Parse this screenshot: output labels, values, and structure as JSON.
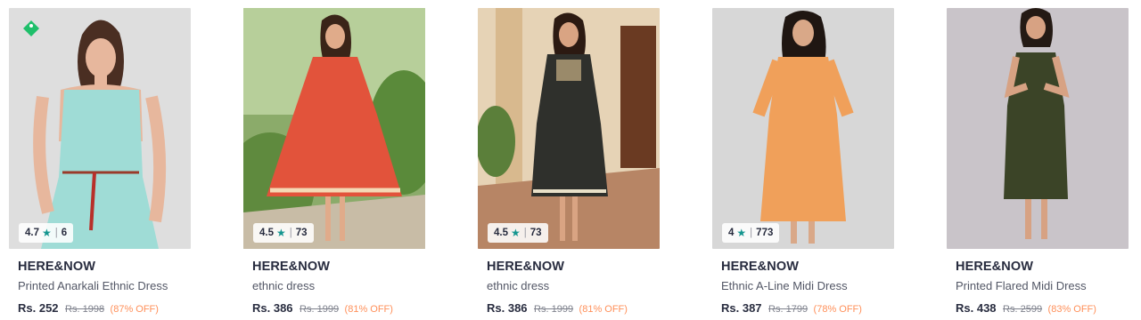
{
  "products": [
    {
      "brand": "HERE&NOW",
      "name": "Printed Anarkali Ethnic Dress",
      "price": "Rs. 252",
      "mrp": "Rs. 1998",
      "discount": "(87% OFF)",
      "rating": "4.7",
      "rating_count": "6",
      "dress_color": "#9fdcd6",
      "has_badge": true
    },
    {
      "brand": "HERE&NOW",
      "name": "ethnic dress",
      "price": "Rs. 386",
      "mrp": "Rs. 1999",
      "discount": "(81% OFF)",
      "rating": "4.5",
      "rating_count": "73",
      "dress_color": "#e2533b"
    },
    {
      "brand": "HERE&NOW",
      "name": "ethnic dress",
      "price": "Rs. 386",
      "mrp": "Rs. 1999",
      "discount": "(81% OFF)",
      "rating": "4.5",
      "rating_count": "73",
      "dress_color": "#2f302c"
    },
    {
      "brand": "HERE&NOW",
      "name": "Ethnic A-Line Midi Dress",
      "price": "Rs. 387",
      "mrp": "Rs. 1799",
      "discount": "(78% OFF)",
      "rating": "4",
      "rating_count": "773",
      "dress_color": "#f0a05a"
    },
    {
      "brand": "HERE&NOW",
      "name": "Printed Flared Midi Dress",
      "price": "Rs. 438",
      "mrp": "Rs. 2599",
      "discount": "(83% OFF)",
      "rating": "",
      "rating_count": "",
      "dress_color": "#3b4427"
    }
  ],
  "icons": {
    "rating_star": "star-icon",
    "badge": "tag-badge-icon"
  },
  "colors": {
    "rating_star": "#14958f",
    "discount": "#ff905a",
    "badge": "#1fbf6a"
  }
}
